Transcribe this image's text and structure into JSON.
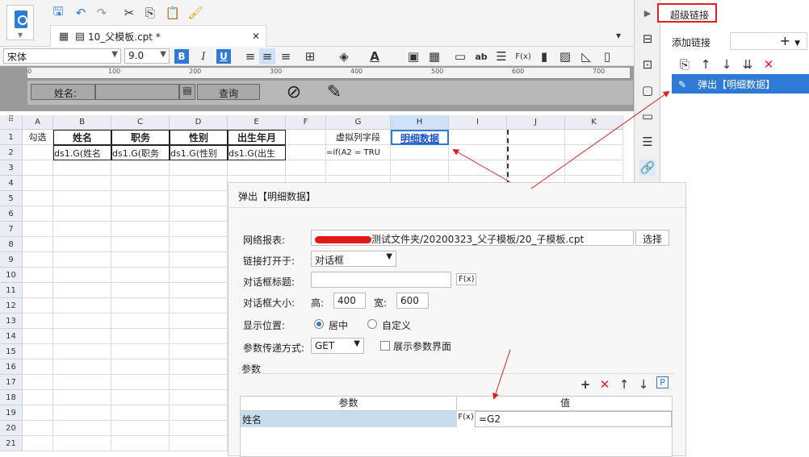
{
  "tab": {
    "title": "10_父模板.cpt *"
  },
  "font": {
    "family": "宋体",
    "size": "9.0"
  },
  "param_bar": {
    "name_label": "姓名:",
    "query_button": "查询"
  },
  "ruler": [
    "0",
    "100",
    "200",
    "300",
    "400",
    "500",
    "600",
    "700"
  ],
  "columns": [
    "A",
    "B",
    "C",
    "D",
    "E",
    "F",
    "G",
    "H",
    "I",
    "J",
    "K"
  ],
  "rows": [
    "1",
    "2",
    "3",
    "4",
    "5",
    "6",
    "7",
    "8",
    "9",
    "10",
    "11",
    "12",
    "13",
    "14",
    "15",
    "16",
    "17",
    "18",
    "19",
    "20",
    "21"
  ],
  "row1": {
    "A": "勾选",
    "B": "姓名",
    "C": "职务",
    "D": "性别",
    "E": "出生年月",
    "G": "虚拟列字段",
    "H": "明细数据"
  },
  "row2": {
    "B": "ds1.G(姓名",
    "C": "ds1.G(职务",
    "D": "ds1.G(性别",
    "E": "ds1.G(出生",
    "G": "=if(A2 = TRU"
  },
  "right_panel": {
    "title": "超级链接",
    "add_label": "添加链接",
    "list": [
      "弹出【明细数据】"
    ]
  },
  "dialog": {
    "title": "弹出【明细数据】",
    "report_label": "网络报表:",
    "report_path": "测试文件夹/20200323_父子模板/20_子模板.cpt",
    "select_button": "选择",
    "open_label": "链接打开于:",
    "open_value": "对话框",
    "dlg_title_label": "对话框标题:",
    "size_label": "对话框大小:",
    "height_label": "高:",
    "height_value": "400",
    "width_label": "宽:",
    "width_value": "600",
    "position_label": "显示位置:",
    "pos_center": "居中",
    "pos_custom": "自定义",
    "param_pass_label": "参数传递方式:",
    "param_pass_value": "GET",
    "show_param_label": "展示参数界面",
    "params_section": "参数",
    "col_param": "参数",
    "col_value": "值",
    "param_name": "姓名",
    "param_value": "=G2"
  }
}
